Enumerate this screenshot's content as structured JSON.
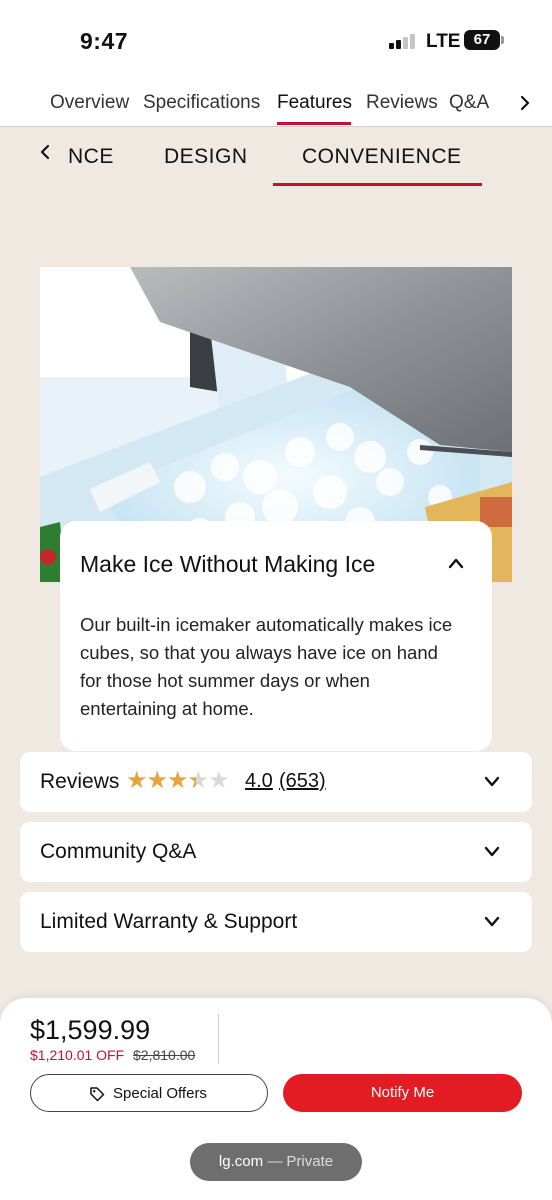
{
  "status_bar": {
    "time": "9:47",
    "network": "LTE",
    "battery": "67"
  },
  "nav": {
    "tabs": [
      "Overview",
      "Specifications",
      "Features",
      "Reviews",
      "Q&A"
    ],
    "active_tab": "Features",
    "next_icon": "chevron-right-icon"
  },
  "sub_tabs": {
    "tabs": [
      "NCE",
      "DESIGN",
      "CONVENIENCE"
    ],
    "active_tab": "CONVENIENCE",
    "prev_icon": "chevron-left-icon"
  },
  "feature": {
    "image": "ice-maker-drawer-photo",
    "title": "Make Ice Without Making Ice",
    "description": "Our built-in icemaker automatically makes ice cubes, so that you always have ice on hand for those hot summer days or when entertaining at home.",
    "expanded": true
  },
  "accordions": {
    "reviews": {
      "label": "Reviews",
      "rating": "4.0",
      "count": "(653)",
      "rating_value": 4.0,
      "rating_max": 5
    },
    "qa": {
      "label": "Community Q&A"
    },
    "warranty": {
      "label": "Limited Warranty & Support"
    }
  },
  "purchase": {
    "price": "$1,599.99",
    "discount": "$1,210.01 OFF",
    "original_price": "$2,810.00",
    "offers_label": "Special Offers",
    "notify_label": "Notify Me"
  },
  "browser": {
    "url": "lg.com",
    "mode": "— Private"
  },
  "colors": {
    "accent": "#c8102e",
    "notify_button": "#e31b23",
    "star": "#e8a33a",
    "page_bg": "#efe9e2"
  }
}
